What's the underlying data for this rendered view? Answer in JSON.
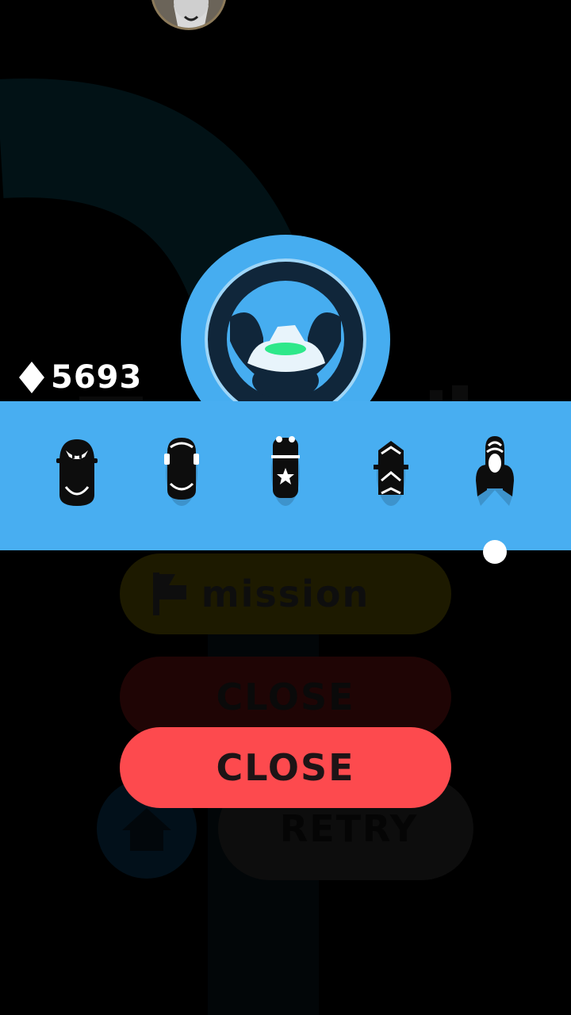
{
  "hud": {
    "gem_icon": "diamond-icon",
    "gems": "5693"
  },
  "vehicles": [
    {
      "name": "vehicle-1",
      "icon": "car-icon"
    },
    {
      "name": "vehicle-2",
      "icon": "car-icon"
    },
    {
      "name": "vehicle-3",
      "icon": "police-car-icon"
    },
    {
      "name": "vehicle-4",
      "icon": "chevron-car-icon"
    },
    {
      "name": "vehicle-5",
      "icon": "rocket-icon"
    }
  ],
  "buttons": {
    "mission_label": "mission",
    "close_dim_label": "CLOSE",
    "close_label": "CLOSE",
    "retry_label": "RETRY"
  },
  "colors": {
    "strip": "#48aef1",
    "badge": "#46adf0",
    "close": "#fd4a4e",
    "highlight": "#2ee88a"
  }
}
